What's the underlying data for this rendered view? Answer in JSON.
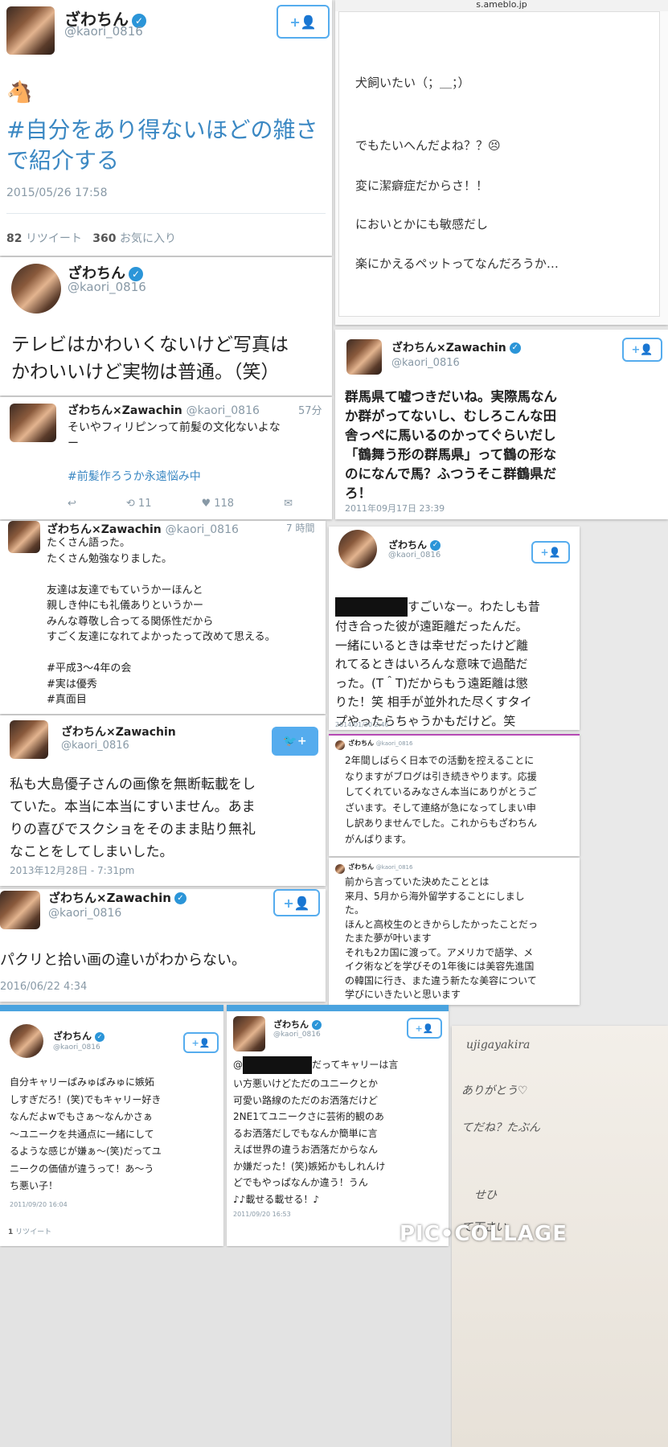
{
  "collage_watermark": "PIC•COLLAGE",
  "tweet1": {
    "name": "ざわちん",
    "handle": "@kaori_0816",
    "emoji": "🐴",
    "hashtag": "#自分をあり得ないほどの雑さで紹介する",
    "date": "2015/05/26 17:58",
    "retweets": "82",
    "retweets_label": "リツイート",
    "likes": "360",
    "likes_label": "お気に入り"
  },
  "blog": {
    "url": "s.ameblo.jp",
    "lines": [
      "犬飼いたい（；＿；）",
      "でもたいへんだよね？？😣",
      "変に潔癖症だからさ！！",
      "においとかにも敏感だし",
      "楽にかえるペットってなんだろうか…"
    ]
  },
  "tweet2": {
    "name": "ざわちん",
    "handle": "@kaori_0816",
    "text": "テレビはかわいくないけど写真は\nかわいいけど実物は普通。（笑）"
  },
  "tweet3": {
    "name": "ざわちん×Zawachin",
    "handle": "@kaori_0816",
    "time": "57分",
    "text": "そいやフィリピンって前髪の文化ないよな\nー",
    "hashtag": "#前髪作ろうか永遠悩み中",
    "retweets": "11",
    "likes": "118"
  },
  "tweet4": {
    "name": "ざわちん×Zawachin",
    "handle": "@kaori_0816",
    "text": "群馬県て嘘つきだいね。実際馬なん\nか群がってないし、むしろこんな田\n舎っぺに馬いるのかってぐらいだし\n「鶴舞う形の群馬県」って鶴の形な\nのになんで馬？ふつうそこ群鶴県だ\nろ！",
    "date": "2011年09月17日 23:39"
  },
  "tweet5": {
    "name": "ざわちん×Zawachin",
    "handle": "@kaori_0816",
    "time": "7 時間",
    "text": "たくさん語った。\nたくさん勉強なりました。\n\n友達は友達でもていうかーほんと\n親しき仲にも礼儀ありというかー\nみんな尊敬し合ってる関係性だから\nすごく友達になれてよかったって改めて思える。\n\n#平成3〜4年の会\n#実は優秀\n#真面目"
  },
  "tweet6": {
    "name": "ざわちん",
    "handle": "@kaori_0816",
    "text_after_redaction": "すごいなー。わたしも昔",
    "text": "付き合った彼が遠距離だったんだ。\n一緒にいるときは幸せだったけど離\nれてるときはいろんな意味で過酷だ\nった。(T＾T)だからもう遠距離は懲\nりた！笑 相手が並外れた尽くすタイ\nプやったらちゃうかもだけど。笑",
    "date": "2014/01/30 2:46"
  },
  "tweet7": {
    "name": "ざわちん×Zawachin",
    "handle": "@kaori_0816",
    "text": "私も大島優子さんの画像を無断転載をし\nていた。本当に本当にすいません。あま\nりの喜びでスクショをそのまま貼り無礼\nなことをしてしまいした。",
    "date": "2013年12月28日 - 7:31pm"
  },
  "tweet8": {
    "name": "ざわちん",
    "handle": "@kaori_0816",
    "text": "2年間しばらく日本での活動を控えることに\nなりますがブログは引き続きやります。応援\nしてくれているみなさん本当にありがとうご\nざいます。そして連絡が急になってしまい申\nし訳ありませんでした。これからもざわちん\nがんばります。"
  },
  "tweet9": {
    "name": "ざわちん",
    "handle": "@kaori_0816",
    "text": "前から言っていた決めたこととは\n来月、5月から海外留学することにしまし\nた。\nほんと高校生のときからしたかったことだっ\nたまた夢が叶います\nそれも2カ国に渡って。アメリカで語学、メ\nイク術などを学びその1年後には美容先進国\nの韓国に行き、また違う新たな美容について\n学びにいきたいと思います"
  },
  "tweet10": {
    "name": "ざわちん×Zawachin",
    "handle": "@kaori_0816",
    "text": "パクリと拾い画の違いがわからない。",
    "date": "2016/06/22 4:34"
  },
  "tweet11": {
    "name": "ざわちん",
    "handle": "@kaori_0816",
    "text": "自分キャリーぱみゅぱみゅに嫉妬\nしすぎだろ！(笑)でもキャリー好き\nなんだよwでもさぁ〜なんかさぁ\n〜ユニークを共通点に一緒にして\nるような感じが嫌ぁ〜(笑)だってユ\nニークの価値が違うって！あ〜う\nち悪い子！",
    "date": "2011/09/20 16:04",
    "retweets": "1",
    "retweets_label": "リツイート"
  },
  "tweet12": {
    "name": "ざわちん",
    "handle": "@kaori_0816",
    "text_prefix": "@",
    "text_after_redaction": "だってキャリーは言",
    "text": "い方悪いけどただのユニークとか\n可愛い路線のただのお洒落だけど\n2NE1てユニークさに芸術的観のあ\nるお洒落だしでもなんか簡単に言\nえば世界の違うお洒落だからなん\nか嫌だった！(笑)嫉妬かもしれんけ\nどでもやっぱなんか違う！うん\n♪♪載せる載せる！♪",
    "date": "2011/09/20 16:53"
  },
  "handwritten": {
    "lines": [
      "ujigayakira",
      "ありがとう♡",
      "てだね？たぶん",
      "せひ",
      "て下さい"
    ]
  }
}
